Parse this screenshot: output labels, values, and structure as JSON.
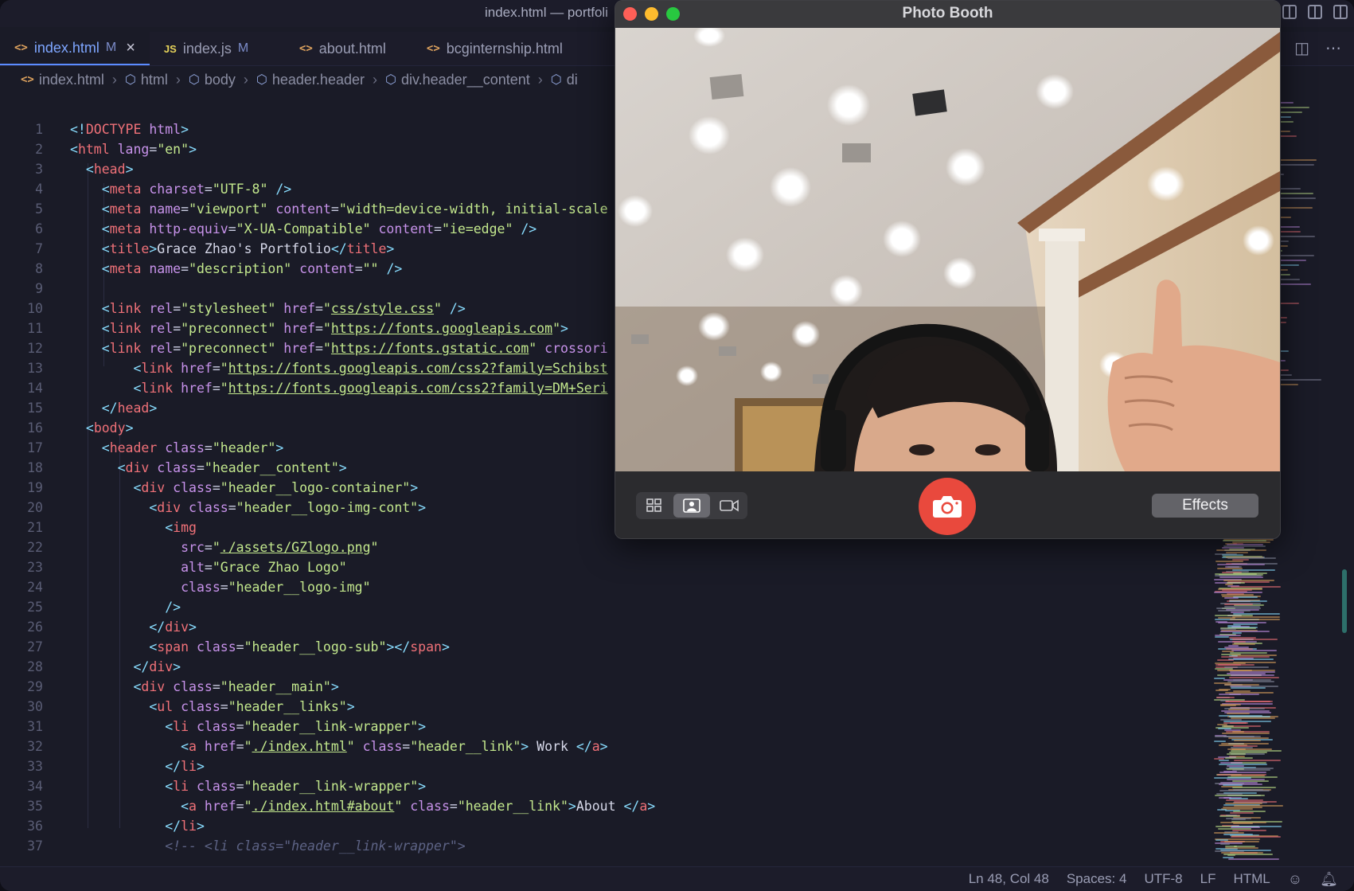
{
  "window_title": "index.html — portfoli",
  "tabs": [
    {
      "icon": "<>",
      "label": "index.html",
      "modified": "M",
      "close": "×"
    },
    {
      "icon": "JS",
      "label": "index.js",
      "modified": "M"
    },
    {
      "icon": "<>",
      "label": "about.html"
    },
    {
      "icon": "<>",
      "label": "bcginternship.html"
    }
  ],
  "breadcrumb": [
    "index.html",
    "html",
    "body",
    "header.header",
    "div.header__content",
    "di"
  ],
  "code_lines": [
    {
      "n": "1",
      "html": "<span class='ang'>&lt;!</span><span class='tg'>DOCTYPE</span> <span class='at'>html</span><span class='ang'>&gt;</span>"
    },
    {
      "n": "2",
      "html": "<span class='ang'>&lt;</span><span class='tg'>html</span> <span class='at'>lang</span>=<span class='st'>\"en\"</span><span class='ang'>&gt;</span>"
    },
    {
      "n": "3",
      "html": "  <span class='ang'>&lt;</span><span class='tg'>head</span><span class='ang'>&gt;</span>"
    },
    {
      "n": "4",
      "html": "    <span class='ang'>&lt;</span><span class='tg'>meta</span> <span class='at'>charset</span>=<span class='st'>\"UTF-8\"</span> <span class='ang'>/&gt;</span>"
    },
    {
      "n": "5",
      "html": "    <span class='ang'>&lt;</span><span class='tg'>meta</span> <span class='at'>name</span>=<span class='st'>\"viewport\"</span> <span class='at'>content</span>=<span class='st'>\"width=device-width, initial-scale</span>"
    },
    {
      "n": "6",
      "html": "    <span class='ang'>&lt;</span><span class='tg'>meta</span> <span class='at'>http-equiv</span>=<span class='st'>\"X-UA-Compatible\"</span> <span class='at'>content</span>=<span class='st'>\"ie=edge\"</span> <span class='ang'>/&gt;</span>"
    },
    {
      "n": "7",
      "html": "    <span class='ang'>&lt;</span><span class='tg'>title</span><span class='ang'>&gt;</span><span class='tx'>Grace Zhao's Portfolio</span><span class='ang'>&lt;/</span><span class='tg'>title</span><span class='ang'>&gt;</span>"
    },
    {
      "n": "8",
      "html": "    <span class='ang'>&lt;</span><span class='tg'>meta</span> <span class='at'>name</span>=<span class='st'>\"description\"</span> <span class='at'>content</span>=<span class='st'>\"\"</span> <span class='ang'>/&gt;</span>"
    },
    {
      "n": "9",
      "html": ""
    },
    {
      "n": "10",
      "html": "    <span class='ang'>&lt;</span><span class='tg'>link</span> <span class='at'>rel</span>=<span class='st'>\"stylesheet\"</span> <span class='at'>href</span>=<span class='st'>\"</span><span class='url'>css/style.css</span><span class='st'>\"</span> <span class='ang'>/&gt;</span>"
    },
    {
      "n": "11",
      "html": "    <span class='ang'>&lt;</span><span class='tg'>link</span> <span class='at'>rel</span>=<span class='st'>\"preconnect\"</span> <span class='at'>href</span>=<span class='st'>\"</span><span class='url'>https://fonts.googleapis.com</span><span class='st'>\"</span><span class='ang'>&gt;</span>"
    },
    {
      "n": "12",
      "html": "    <span class='ang'>&lt;</span><span class='tg'>link</span> <span class='at'>rel</span>=<span class='st'>\"preconnect\"</span> <span class='at'>href</span>=<span class='st'>\"</span><span class='url'>https://fonts.gstatic.com</span><span class='st'>\"</span> <span class='at'>crossori</span>"
    },
    {
      "n": "13",
      "html": "        <span class='ang'>&lt;</span><span class='tg'>link</span> <span class='at'>href</span>=<span class='st'>\"</span><span class='url'>https://fonts.googleapis.com/css2?family=Schibst</span>"
    },
    {
      "n": "14",
      "html": "        <span class='ang'>&lt;</span><span class='tg'>link</span> <span class='at'>href</span>=<span class='st'>\"</span><span class='url'>https://fonts.googleapis.com/css2?family=DM+Seri</span>"
    },
    {
      "n": "15",
      "html": "    <span class='ang'>&lt;/</span><span class='tg'>head</span><span class='ang'>&gt;</span>"
    },
    {
      "n": "16",
      "html": "  <span class='ang'>&lt;</span><span class='tg'>body</span><span class='ang'>&gt;</span>"
    },
    {
      "n": "17",
      "html": "    <span class='ang'>&lt;</span><span class='tg'>header</span> <span class='at'>class</span>=<span class='st'>\"header\"</span><span class='ang'>&gt;</span>"
    },
    {
      "n": "18",
      "html": "      <span class='ang'>&lt;</span><span class='tg'>div</span> <span class='at'>class</span>=<span class='st'>\"header__content\"</span><span class='ang'>&gt;</span>"
    },
    {
      "n": "19",
      "html": "        <span class='ang'>&lt;</span><span class='tg'>div</span> <span class='at'>class</span>=<span class='st'>\"header__logo-container\"</span><span class='ang'>&gt;</span>"
    },
    {
      "n": "20",
      "html": "          <span class='ang'>&lt;</span><span class='tg'>div</span> <span class='at'>class</span>=<span class='st'>\"header__logo-img-cont\"</span><span class='ang'>&gt;</span>"
    },
    {
      "n": "21",
      "html": "            <span class='ang'>&lt;</span><span class='tg'>img</span>"
    },
    {
      "n": "22",
      "html": "              <span class='at'>src</span>=<span class='st'>\"</span><span class='url'>./assets/GZlogo.png</span><span class='st'>\"</span>"
    },
    {
      "n": "23",
      "html": "              <span class='at'>alt</span>=<span class='st'>\"Grace Zhao Logo\"</span>"
    },
    {
      "n": "24",
      "html": "              <span class='at'>class</span>=<span class='st'>\"header__logo-img\"</span>"
    },
    {
      "n": "25",
      "html": "            <span class='ang'>/&gt;</span>"
    },
    {
      "n": "26",
      "html": "          <span class='ang'>&lt;/</span><span class='tg'>div</span><span class='ang'>&gt;</span>"
    },
    {
      "n": "27",
      "html": "          <span class='ang'>&lt;</span><span class='tg'>span</span> <span class='at'>class</span>=<span class='st'>\"header__logo-sub\"</span><span class='ang'>&gt;&lt;/</span><span class='tg'>span</span><span class='ang'>&gt;</span>"
    },
    {
      "n": "28",
      "html": "        <span class='ang'>&lt;/</span><span class='tg'>div</span><span class='ang'>&gt;</span>"
    },
    {
      "n": "29",
      "html": "        <span class='ang'>&lt;</span><span class='tg'>div</span> <span class='at'>class</span>=<span class='st'>\"header__main\"</span><span class='ang'>&gt;</span>"
    },
    {
      "n": "30",
      "html": "          <span class='ang'>&lt;</span><span class='tg'>ul</span> <span class='at'>class</span>=<span class='st'>\"header__links\"</span><span class='ang'>&gt;</span>"
    },
    {
      "n": "31",
      "html": "            <span class='ang'>&lt;</span><span class='tg'>li</span> <span class='at'>class</span>=<span class='st'>\"header__link-wrapper\"</span><span class='ang'>&gt;</span>"
    },
    {
      "n": "32",
      "html": "              <span class='ang'>&lt;</span><span class='tg'>a</span> <span class='at'>href</span>=<span class='st'>\"</span><span class='url'>./index.html</span><span class='st'>\"</span> <span class='at'>class</span>=<span class='st'>\"header__link\"</span><span class='ang'>&gt;</span><span class='tx'> Work </span><span class='ang'>&lt;/</span><span class='tg'>a</span><span class='ang'>&gt;</span>"
    },
    {
      "n": "33",
      "html": "            <span class='ang'>&lt;/</span><span class='tg'>li</span><span class='ang'>&gt;</span>"
    },
    {
      "n": "34",
      "html": "            <span class='ang'>&lt;</span><span class='tg'>li</span> <span class='at'>class</span>=<span class='st'>\"header__link-wrapper\"</span><span class='ang'>&gt;</span>"
    },
    {
      "n": "35",
      "html": "              <span class='ang'>&lt;</span><span class='tg'>a</span> <span class='at'>href</span>=<span class='st'>\"</span><span class='url'>./index.html#about</span><span class='st'>\"</span> <span class='at'>class</span>=<span class='st'>\"header__link\"</span><span class='ang'>&gt;</span><span class='tx'>About </span><span class='ang'>&lt;/</span><span class='tg'>a</span><span class='ang'>&gt;</span>"
    },
    {
      "n": "36",
      "html": "            <span class='ang'>&lt;/</span><span class='tg'>li</span><span class='ang'>&gt;</span>"
    },
    {
      "n": "37",
      "html": "            <span class='cm'>&lt;!-- &lt;li class=\"header__link-wrapper\"&gt;</span>"
    }
  ],
  "status": {
    "position": "Ln 48, Col 48",
    "spaces": "Spaces: 4",
    "encoding": "UTF-8",
    "eol": "LF",
    "language": "HTML"
  },
  "photobooth": {
    "title": "Photo Booth",
    "effects_label": "Effects",
    "shutter_icon": "camera-icon",
    "view_modes": [
      "grid-icon",
      "portrait-icon",
      "video-icon"
    ],
    "selected_view_mode": "portrait-icon"
  },
  "colors": {
    "editor_bg": "#1a1b27",
    "accent": "#5b8cff",
    "shutter": "#e9493d",
    "close": "#fe5f57",
    "minimize": "#febc2e",
    "zoom": "#28c840"
  }
}
